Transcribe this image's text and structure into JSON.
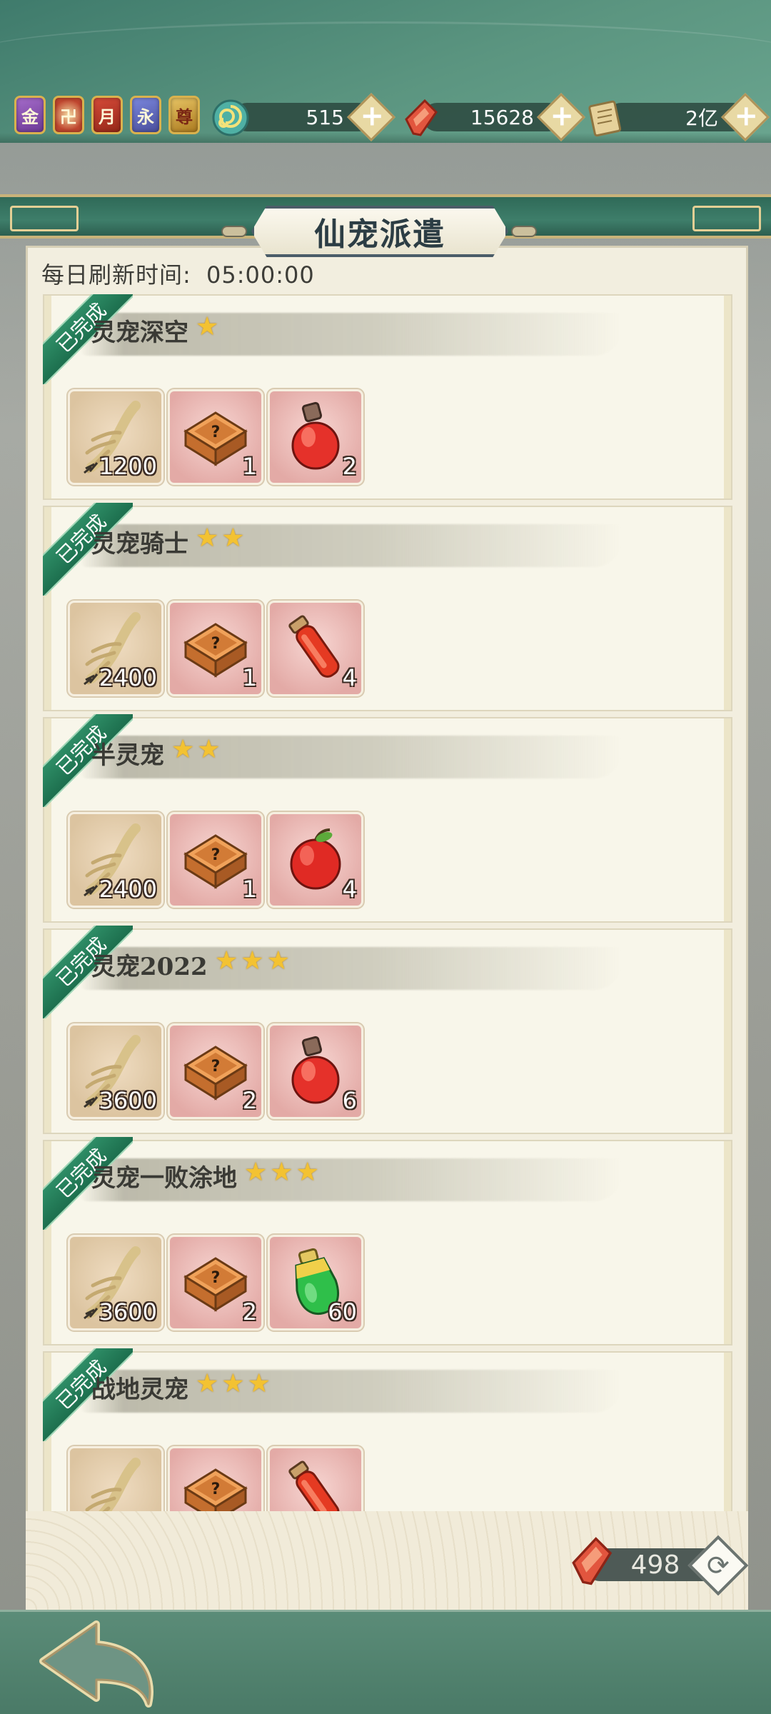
{
  "header": {
    "badges": [
      {
        "name": "jin-badge",
        "glyph": "金"
      },
      {
        "name": "emblem-badge",
        "glyph": "卍"
      },
      {
        "name": "yue-badge",
        "glyph": "月"
      },
      {
        "name": "yong-badge",
        "glyph": "永"
      },
      {
        "name": "zun-badge",
        "glyph": "尊"
      }
    ],
    "resources": [
      {
        "icon": "spiral-token-icon",
        "value": "515"
      },
      {
        "icon": "red-crystal-icon",
        "value": "15628"
      },
      {
        "icon": "scroll-icon",
        "value": "2亿"
      }
    ]
  },
  "panel": {
    "title": "仙宠派遣",
    "refresh_label": "每日刷新时间:",
    "refresh_time": "05:00:00"
  },
  "missions": [
    {
      "status": "已完成",
      "name": "灵宠深空",
      "stars": 1,
      "rewards": [
        {
          "icon": "ginseng-icon",
          "qty": "1200"
        },
        {
          "icon": "mystery-box-icon",
          "qty": "1"
        },
        {
          "icon": "red-flask-icon",
          "qty": "2"
        }
      ]
    },
    {
      "status": "已完成",
      "name": "灵宠骑士",
      "stars": 2,
      "rewards": [
        {
          "icon": "ginseng-icon",
          "qty": "2400"
        },
        {
          "icon": "mystery-box-icon",
          "qty": "1"
        },
        {
          "icon": "red-vial-icon",
          "qty": "4"
        }
      ]
    },
    {
      "status": "已完成",
      "name": "半灵宠",
      "stars": 2,
      "rewards": [
        {
          "icon": "ginseng-icon",
          "qty": "2400"
        },
        {
          "icon": "mystery-box-icon",
          "qty": "1"
        },
        {
          "icon": "red-fruit-icon",
          "qty": "4"
        }
      ]
    },
    {
      "status": "已完成",
      "name": "灵宠2022",
      "stars": 3,
      "rewards": [
        {
          "icon": "ginseng-icon",
          "qty": "3600"
        },
        {
          "icon": "mystery-box-icon",
          "qty": "2"
        },
        {
          "icon": "red-flask-icon",
          "qty": "6"
        }
      ]
    },
    {
      "status": "已完成",
      "name": "灵宠一败涂地",
      "stars": 3,
      "rewards": [
        {
          "icon": "ginseng-icon",
          "qty": "3600"
        },
        {
          "icon": "mystery-box-icon",
          "qty": "2"
        },
        {
          "icon": "green-potion-icon",
          "qty": "60"
        }
      ]
    },
    {
      "status": "已完成",
      "name": "战地灵宠",
      "stars": 3,
      "rewards": [
        {
          "icon": "ginseng-icon",
          "qty": ""
        },
        {
          "icon": "mystery-box-icon",
          "qty": ""
        },
        {
          "icon": "red-vial-icon",
          "qty": ""
        }
      ]
    }
  ],
  "footer": {
    "refresh_cost": "498",
    "cost_icon": "red-crystal-icon",
    "refresh_icon": "refresh-icon",
    "back_icon": "back-arrow-icon"
  },
  "colors": {
    "accent_green": "#2e8d66",
    "star_gold": "#f3c232",
    "panel_bg": "#f2eedf"
  }
}
